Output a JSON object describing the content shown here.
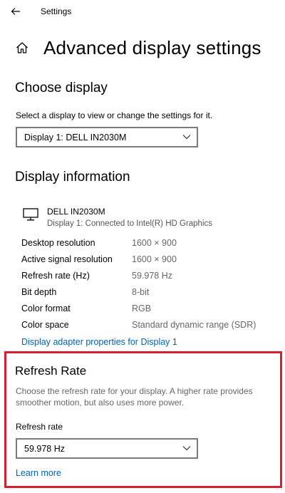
{
  "titlebar": {
    "app_title": "Settings",
    "back_icon": "arrow-left-icon"
  },
  "page": {
    "title": "Advanced display settings",
    "home_icon": "home-icon"
  },
  "choose_display": {
    "heading": "Choose display",
    "description": "Select a display to view or change the settings for it.",
    "selected": "Display 1: DELL IN2030M"
  },
  "display_info": {
    "heading": "Display information",
    "monitor_icon": "monitor-icon",
    "monitor_name": "DELL IN2030M",
    "monitor_connection": "Display 1: Connected to Intel(R) HD Graphics",
    "rows": [
      {
        "label": "Desktop resolution",
        "value": "1600 × 900"
      },
      {
        "label": "Active signal resolution",
        "value": "1600 × 900"
      },
      {
        "label": "Refresh rate (Hz)",
        "value": "59.978 Hz"
      },
      {
        "label": "Bit depth",
        "value": "8-bit"
      },
      {
        "label": "Color format",
        "value": "RGB"
      },
      {
        "label": "Color space",
        "value": "Standard dynamic range (SDR)"
      }
    ],
    "adapter_link": "Display adapter properties for Display 1"
  },
  "refresh_rate": {
    "heading": "Refresh Rate",
    "description": "Choose the refresh rate for your display. A higher rate provides smoother motion, but also uses more power.",
    "field_label": "Refresh rate",
    "selected": "59.978 Hz",
    "learn_more": "Learn more"
  },
  "colors": {
    "link": "#0063b1",
    "highlight_border": "#d62031",
    "secondary_text": "#666666"
  }
}
